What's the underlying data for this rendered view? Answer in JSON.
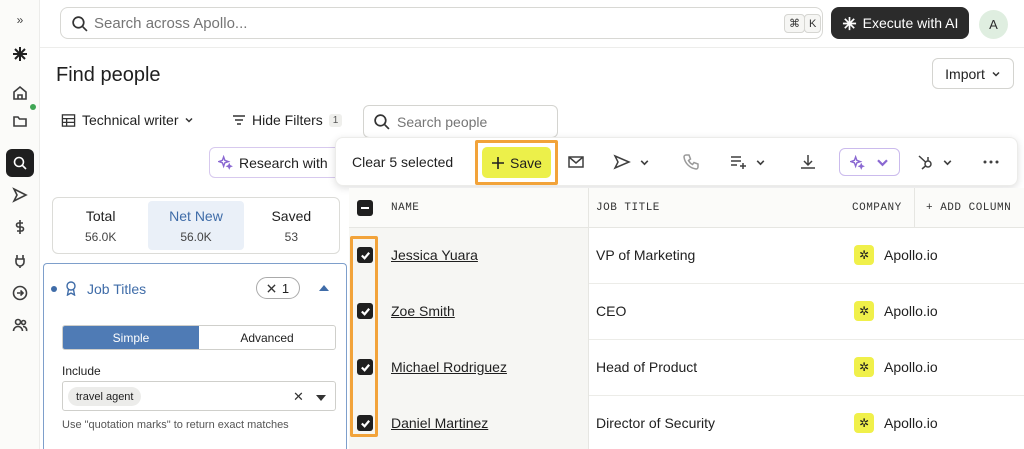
{
  "topbar": {
    "search_placeholder": "Search across Apollo...",
    "shortcut_cmd": "⌘",
    "shortcut_key": "K",
    "execute_label": "Execute with AI",
    "avatar_initial": "A"
  },
  "page": {
    "title": "Find people",
    "import_label": "Import"
  },
  "toolbar": {
    "view_label": "Technical writer",
    "hide_filters_label": "Hide Filters",
    "filter_count": "1",
    "search_people_placeholder": "Search people",
    "research_label": "Research with"
  },
  "action_bar": {
    "clear_label": "Clear 5 selected",
    "save_label": "Save"
  },
  "stats": [
    {
      "label": "Total",
      "value": "56.0K"
    },
    {
      "label": "Net New",
      "value": "56.0K"
    },
    {
      "label": "Saved",
      "value": "53"
    }
  ],
  "job_titles": {
    "label": "Job Titles",
    "count": "1",
    "mode_simple": "Simple",
    "mode_advanced": "Advanced",
    "include_label": "Include",
    "chip": "travel agent",
    "hint": "Use \"quotation marks\" to return exact matches"
  },
  "table": {
    "headers": {
      "name": "NAME",
      "job_title": "JOB TITLE",
      "company": "COMPANY",
      "add_column": "+ ADD COLUMN"
    },
    "rows": [
      {
        "name": "Jessica Yuara",
        "title": "VP of Marketing",
        "company": "Apollo.io"
      },
      {
        "name": "Zoe Smith",
        "title": "CEO",
        "company": "Apollo.io"
      },
      {
        "name": "Michael Rodriguez",
        "title": "Head of Product",
        "company": "Apollo.io"
      },
      {
        "name": "Daniel Martinez",
        "title": "Director of Security",
        "company": "Apollo.io"
      }
    ]
  },
  "colors": {
    "accent_blue": "#3f6ca8",
    "save_yellow": "#ecf04a",
    "highlight_orange": "#f2a33a"
  }
}
